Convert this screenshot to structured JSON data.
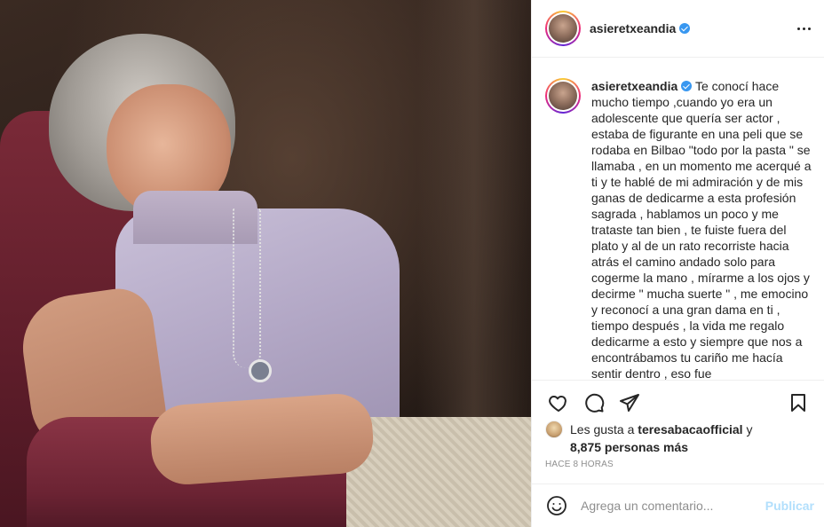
{
  "post": {
    "author": {
      "username": "asieretxeandia",
      "verified": true
    },
    "caption": "Te conocí hace mucho tiempo ,cuando yo era un adolescente que quería ser actor , estaba de figurante en una peli que se rodaba en Bilbao \"todo por la pasta \" se llamaba , en un momento me acerqué a ti y te hablé de mi admiración y de mis ganas de dedicarme a esta profesión sagrada , hablamos un poco y me trataste tan bien , te fuiste fuera del plato y al de un rato recorriste hacia atrás el camino andado solo para cogerme la mano , mírarme a los ojos y decirme \" mucha suerte \" , me emocino y reconocí a una gran dama en ti , tiempo después , la vida me regalo dedicarme a esto y siempre que nos a encontrábamos tu cariño me hacía sentir dentro , eso fue",
    "likes": {
      "prefix": "Les gusta a",
      "user": "teresabacaofficial",
      "conjunction": "y",
      "others": "8,875 personas más"
    },
    "timestamp": "HACE 8 HORAS"
  },
  "comment_box": {
    "placeholder": "Agrega un comentario...",
    "post_label": "Publicar"
  },
  "icons": {
    "more": "more-options-icon",
    "like": "heart-icon",
    "comment": "comment-icon",
    "share": "share-icon",
    "save": "bookmark-icon",
    "emoji": "emoji-icon"
  },
  "colors": {
    "verified": "#3897f0",
    "post_button_disabled": "#b2dffc",
    "muted": "#8e8e8e",
    "text": "#262626"
  }
}
